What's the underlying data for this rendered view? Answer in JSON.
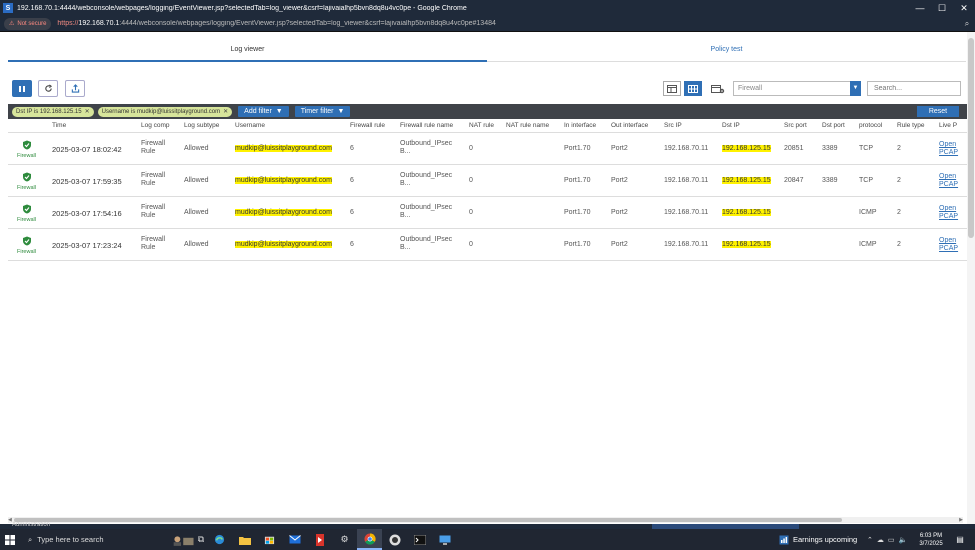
{
  "window": {
    "title": "192.168.70.1:4444/webconsole/webpages/logging/EventViewer.jsp?selectedTab=log_viewer&csrf=lajivaialhp5bvn8dq8u4vc0pe - Google Chrome",
    "favicon_letter": "S",
    "minimize": "—",
    "maximize": "☐",
    "close": "✕"
  },
  "address_bar": {
    "security_label": "Not secure",
    "scheme": "https://",
    "host": "192.168.70.1",
    "rest": ":4444/webconsole/webpages/logging/EventViewer.jsp?selectedTab=log_viewer&csrf=lajivaialhp5bvn8dq8u4vc0pe#13484"
  },
  "tabs": [
    {
      "label": "Log viewer",
      "active": true
    },
    {
      "label": "Policy test",
      "active": false
    }
  ],
  "toolbar": {
    "module_select": "Firewall",
    "search_placeholder": "Search..."
  },
  "filters": {
    "chips": [
      "Dst IP is 192.168.125.15",
      "Username is mudkip@luissitplayground.com"
    ],
    "add_filter": "Add filter",
    "timer_filter": "Timer filter",
    "reset": "Reset"
  },
  "table": {
    "columns": [
      "Time",
      "Log comp",
      "Log subtype",
      "Username",
      "Firewall rule",
      "Firewall rule name",
      "NAT rule",
      "NAT rule name",
      "In interface",
      "Out interface",
      "Src IP",
      "Dst IP",
      "Src port",
      "Dst port",
      "protocol",
      "Rule type",
      "Live P"
    ],
    "rows": [
      {
        "module": "Firewall",
        "time": "2025-03-07 18:02:42",
        "log_comp_1": "Firewall",
        "log_comp_2": "Rule",
        "subtype": "Allowed",
        "username": "mudkip@luissitplayground.com",
        "fw_rule": "6",
        "fw_rule_name_1": "Outbound_IPsec",
        "fw_rule_name_2": "B...",
        "nat_rule": "0",
        "in_if": "Port1.70",
        "out_if": "Port2",
        "src_ip": "192.168.70.11",
        "dst_ip": "192.168.125.15",
        "src_port": "20851",
        "dst_port": "3389",
        "protocol": "TCP",
        "rule_type": "2",
        "live_1": "Open",
        "live_2": "PCAP"
      },
      {
        "module": "Firewall",
        "time": "2025-03-07 17:59:35",
        "log_comp_1": "Firewall",
        "log_comp_2": "Rule",
        "subtype": "Allowed",
        "username": "mudkip@luissitplayground.com",
        "fw_rule": "6",
        "fw_rule_name_1": "Outbound_IPsec",
        "fw_rule_name_2": "B...",
        "nat_rule": "0",
        "in_if": "Port1.70",
        "out_if": "Port2",
        "src_ip": "192.168.70.11",
        "dst_ip": "192.168.125.15",
        "src_port": "20847",
        "dst_port": "3389",
        "protocol": "TCP",
        "rule_type": "2",
        "live_1": "Open",
        "live_2": "PCAP"
      },
      {
        "module": "Firewall",
        "time": "2025-03-07 17:54:16",
        "log_comp_1": "Firewall",
        "log_comp_2": "Rule",
        "subtype": "Allowed",
        "username": "mudkip@luissitplayground.com",
        "fw_rule": "6",
        "fw_rule_name_1": "Outbound_IPsec",
        "fw_rule_name_2": "B...",
        "nat_rule": "0",
        "in_if": "Port1.70",
        "out_if": "Port2",
        "src_ip": "192.168.70.11",
        "dst_ip": "192.168.125.15",
        "src_port": "",
        "dst_port": "",
        "protocol": "ICMP",
        "rule_type": "2",
        "live_1": "Open",
        "live_2": "PCAP"
      },
      {
        "module": "Firewall",
        "time": "2025-03-07 17:23:24",
        "log_comp_1": "Firewall",
        "log_comp_2": "Rule",
        "subtype": "Allowed",
        "username": "mudkip@luissitplayground.com",
        "fw_rule": "6",
        "fw_rule_name_1": "Outbound_IPsec",
        "fw_rule_name_2": "B...",
        "nat_rule": "0",
        "in_if": "Port1.70",
        "out_if": "Port2",
        "src_ip": "192.168.70.11",
        "dst_ip": "192.168.125.15",
        "src_port": "",
        "dst_port": "",
        "protocol": "ICMP",
        "rule_type": "2",
        "live_1": "Open",
        "live_2": "PCAP"
      }
    ]
  },
  "background_window": {
    "label": "Administration"
  },
  "taskbar": {
    "search_text": "Type here to search",
    "news": "Earnings upcoming",
    "time": "6:03 PM",
    "date": "3/7/2025"
  },
  "colors": {
    "accent": "#2f6fb5",
    "highlight": "#fff200",
    "chip": "#d7e59b",
    "shield": "#2e8b3d"
  }
}
